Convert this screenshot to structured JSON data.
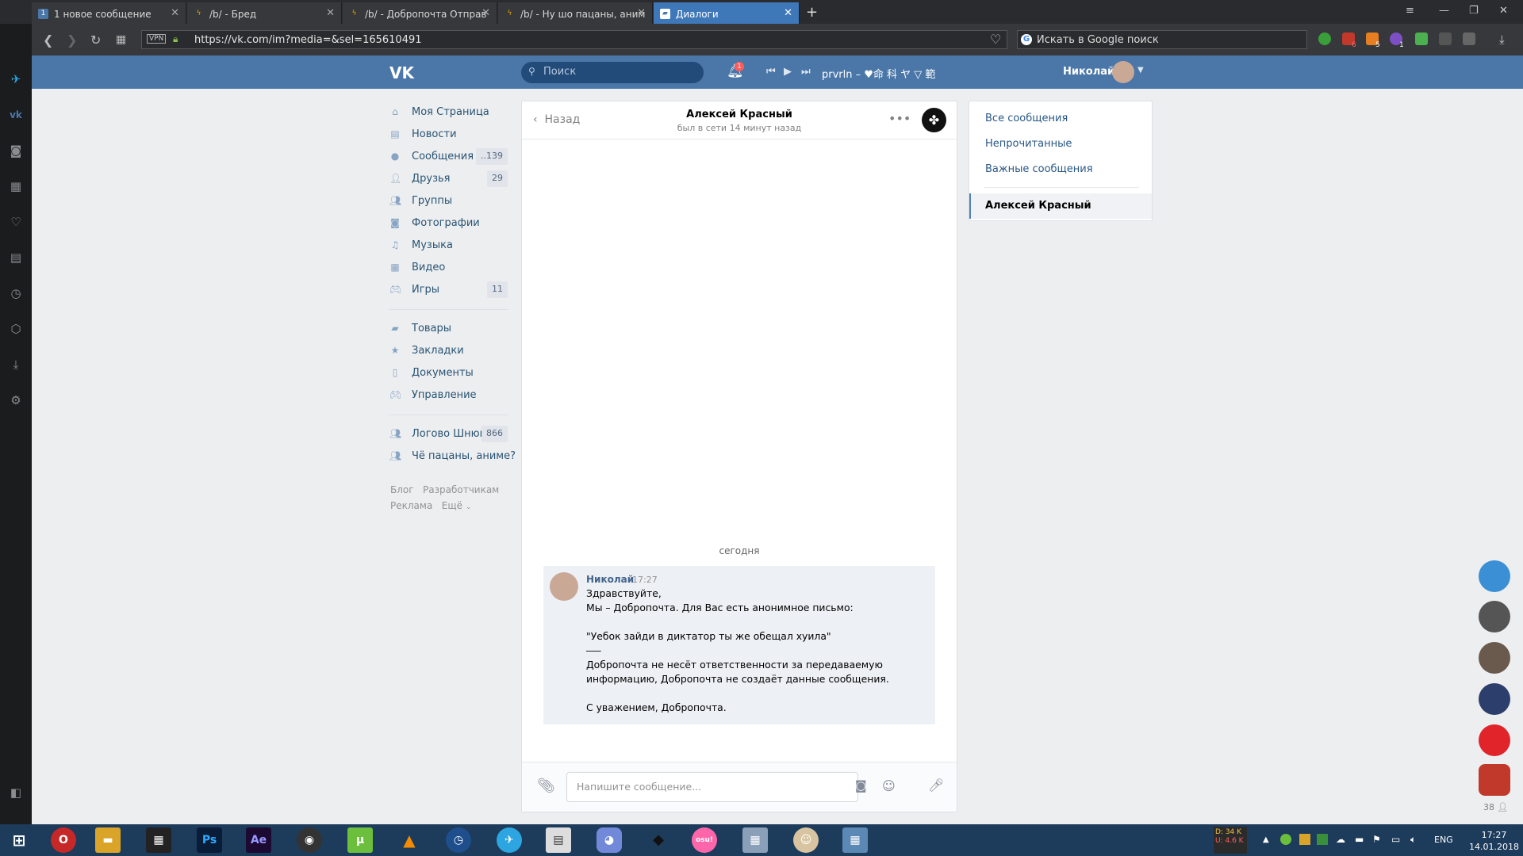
{
  "browser": {
    "tabs": [
      {
        "label": "1 новое сообщение",
        "icon": "vk-count-icon",
        "icon_text": "1"
      },
      {
        "label": "/b/ - Бред",
        "icon": "lightning-icon"
      },
      {
        "label": "/b/ - Добропочта Отправ",
        "icon": "lightning-icon"
      },
      {
        "label": "/b/ - Ну шо пацаны, аним",
        "icon": "lightning-icon"
      },
      {
        "label": "Диалоги",
        "icon": "vk-message-icon",
        "active": true
      }
    ],
    "vpn_label": "VPN",
    "url": "https://vk.com/im?media=&sel=165610491",
    "search_placeholder": "Искать в Google поиск",
    "ext_badges": [
      "6",
      "5",
      "1"
    ]
  },
  "vk": {
    "search_placeholder": "Поиск",
    "notif_count": "1",
    "now_playing": "prvrln – ♥命 科 ヤ ▽ 範",
    "user_name": "Николай",
    "menu": [
      {
        "label": "Моя Страница",
        "icon": "home-icon"
      },
      {
        "label": "Новости",
        "icon": "news-icon"
      },
      {
        "label": "Сообщения",
        "icon": "messages-icon",
        "count": "..139"
      },
      {
        "label": "Друзья",
        "icon": "friends-icon",
        "count": "29"
      },
      {
        "label": "Группы",
        "icon": "groups-icon"
      },
      {
        "label": "Фотографии",
        "icon": "camera-icon"
      },
      {
        "label": "Музыка",
        "icon": "music-icon"
      },
      {
        "label": "Видео",
        "icon": "video-icon"
      },
      {
        "label": "Игры",
        "icon": "games-icon",
        "count": "11"
      }
    ],
    "menu2": [
      {
        "label": "Товары",
        "icon": "bag-icon"
      },
      {
        "label": "Закладки",
        "icon": "star-icon"
      },
      {
        "label": "Документы",
        "icon": "document-icon"
      },
      {
        "label": "Управление",
        "icon": "gamepad-icon"
      }
    ],
    "menu3": [
      {
        "label": "Логово Шнюка",
        "icon": "community-icon",
        "count": "866"
      },
      {
        "label": "Чё пацаны, аниме?",
        "icon": "community-icon"
      }
    ],
    "footer_links": [
      "Блог",
      "Разработчикам",
      "Реклама",
      "Ещё"
    ],
    "chat": {
      "back_label": "Назад",
      "peer_name": "Алексей Красный",
      "peer_status": "был в сети 14 минут назад",
      "day_label": "сегодня",
      "message": {
        "author": "Николай",
        "time": "17:27",
        "lines": [
          "Здравствуйте,",
          "Мы – Добропочта. Для Вас есть анонимное письмо:",
          "",
          "\"Уебок зайди в диктатор ты же обещал хуила\"",
          "___",
          "Добропочта не несёт ответственности за передаваемую",
          "информацию, Добропочта не создаёт данные сообщения.",
          "",
          "С уважением, Добропочта."
        ]
      },
      "input_placeholder": "Напишите сообщение..."
    },
    "right_panel": {
      "filters": [
        "Все сообщения",
        "Непрочитанные",
        "Важные сообщения"
      ],
      "active_dialog": "Алексей Красный"
    },
    "online_count": "38"
  },
  "taskbar": {
    "apps": [
      "opera",
      "explorer",
      "film",
      "Ps",
      "Ae",
      "obs",
      "utorrent",
      "vlc",
      "clock",
      "telegram",
      "app",
      "discord",
      "app2",
      "osu!",
      "app3",
      "app4",
      "app5"
    ],
    "net_down": "D: 34 K",
    "net_up": "U: 4.6 K",
    "lang": "ENG",
    "time": "17:27",
    "date": "14.01.2018"
  }
}
